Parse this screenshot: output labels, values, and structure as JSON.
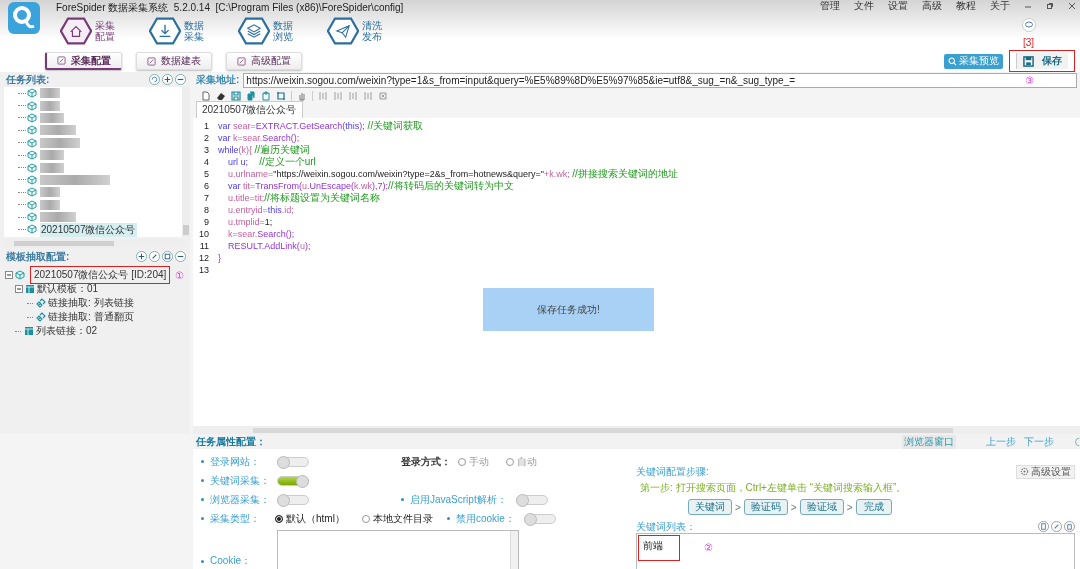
{
  "app": {
    "title": "ForeSpider 数据采集系统  5.2.0.14  [C:\\Program Files (x86)\\ForeSpider\\config]"
  },
  "menu": [
    "管理",
    "文件",
    "设置",
    "高级",
    "教程",
    "关于"
  ],
  "nav": [
    {
      "label": "采集配置",
      "selected": true
    },
    {
      "label": "数据采集",
      "selected": false
    },
    {
      "label": "数据浏览",
      "selected": false
    },
    {
      "label": "清洗发布",
      "selected": false
    }
  ],
  "subtabs": [
    {
      "label": "采集配置",
      "selected": true
    },
    {
      "label": "数据建表",
      "selected": false
    },
    {
      "label": "高级配置",
      "selected": false
    }
  ],
  "actions": {
    "preview": "采集预览",
    "save": {
      "label": "保存",
      "highlighted": true,
      "annotation": "[3]"
    }
  },
  "task_list": {
    "title": "任务列表:",
    "items": [
      {
        "kind": "blurred",
        "selected": false
      },
      {
        "kind": "blurred",
        "selected": false
      },
      {
        "kind": "blurred",
        "selected": false
      },
      {
        "kind": "blurred",
        "selected": false
      },
      {
        "kind": "blurred",
        "selected": false
      },
      {
        "kind": "blurred",
        "selected": false
      },
      {
        "kind": "blurred",
        "selected": false
      },
      {
        "kind": "blurred",
        "selected": false
      },
      {
        "kind": "blurred",
        "selected": false
      },
      {
        "kind": "blurred",
        "selected": false
      },
      {
        "kind": "blurred",
        "selected": false
      },
      {
        "kind": "text",
        "label": "20210507微信公众号",
        "selected": true
      }
    ]
  },
  "template_tree": {
    "title": "模板抽取配置:",
    "root": {
      "label": "20210507微信公众号 [ID:204]",
      "highlighted": true,
      "annotation": "①",
      "expanded": true,
      "children": [
        {
          "kind": "template",
          "label": "默认模板：01",
          "expanded": true,
          "children": [
            {
              "kind": "link",
              "label": "链接抽取: 列表链接"
            },
            {
              "kind": "link",
              "label": "链接抽取: 普通翻页"
            }
          ]
        },
        {
          "kind": "template",
          "label": "列表链接：02"
        }
      ]
    }
  },
  "url": {
    "label": "采集地址:",
    "value": "https://weixin.sogou.com/weixin?type=1&s_from=input&query=%E5%89%8D%E5%97%85&ie=utf8&_sug_=n&_sug_type_=",
    "annotation": "③"
  },
  "editor": {
    "tab": "20210507微信公众号",
    "lines": [
      {
        "number": "1",
        "tokens": [
          {
            "kind": "kw",
            "text": "var "
          },
          {
            "kind": "vr",
            "text": "sear="
          },
          {
            "kind": "fn",
            "text": "EXTRACT.GetSearch("
          },
          {
            "kind": "kw",
            "text": "this"
          },
          {
            "kind": "fn",
            "text": ");"
          },
          {
            "kind": "cm",
            "text": " //关键词获取"
          }
        ]
      },
      {
        "number": "2",
        "tokens": [
          {
            "kind": "kw",
            "text": "var "
          },
          {
            "kind": "vr",
            "text": "k=sear."
          },
          {
            "kind": "fn",
            "text": "Search();"
          }
        ]
      },
      {
        "number": "3",
        "tokens": [
          {
            "kind": "kw",
            "text": "while"
          },
          {
            "kind": "vr",
            "text": "(k){ "
          },
          {
            "kind": "cm",
            "text": "//遍历关键词"
          }
        ]
      },
      {
        "number": "4",
        "tokens": [
          {
            "kind": "kw",
            "text": "    url u;"
          },
          {
            "kind": "cm",
            "text": "    //定义一个url"
          }
        ]
      },
      {
        "number": "5",
        "tokens": [
          {
            "kind": "vr",
            "text": "    u.urlname="
          },
          {
            "kind": "st",
            "text": "\"https://weixin.sogou.com/weixin?type=2&s_from=hotnews&query=\""
          },
          {
            "kind": "vr",
            "text": "+k.wk; "
          },
          {
            "kind": "cm",
            "text": "//拼接搜索关键词的地址"
          }
        ]
      },
      {
        "number": "6",
        "tokens": [
          {
            "kind": "kw",
            "text": "    var "
          },
          {
            "kind": "vr",
            "text": "tit="
          },
          {
            "kind": "fn",
            "text": "TransFrom("
          },
          {
            "kind": "vr",
            "text": "u."
          },
          {
            "kind": "fn",
            "text": "UnEscape("
          },
          {
            "kind": "vr",
            "text": "k.wk"
          },
          {
            "kind": "fn",
            "text": "),7);"
          },
          {
            "kind": "cm",
            "text": "//将转码后的关键词转为中文"
          }
        ]
      },
      {
        "number": "7",
        "tokens": [
          {
            "kind": "vr",
            "text": "    u.title=tit;"
          },
          {
            "kind": "cm",
            "text": "//将标题设置为关键词名称"
          }
        ]
      },
      {
        "number": "8",
        "tokens": [
          {
            "kind": "vr",
            "text": "    u.entryid="
          },
          {
            "kind": "kw",
            "text": "this"
          },
          {
            "kind": "vr",
            "text": ".id;"
          }
        ]
      },
      {
        "number": "9",
        "tokens": [
          {
            "kind": "vr",
            "text": "    u.tmplid="
          },
          {
            "kind": "st",
            "text": "1;"
          }
        ]
      },
      {
        "number": "10",
        "tokens": [
          {
            "kind": "vr",
            "text": "    k=sear."
          },
          {
            "kind": "fn",
            "text": "Search();"
          }
        ]
      },
      {
        "number": "11",
        "tokens": [
          {
            "kind": "fn",
            "text": "    RESULT.AddLink("
          },
          {
            "kind": "vr",
            "text": "u"
          },
          {
            "kind": "fn",
            "text": ");"
          }
        ]
      },
      {
        "number": "12",
        "tokens": [
          {
            "kind": "fn",
            "text": "}"
          }
        ]
      },
      {
        "number": "13"
      }
    ]
  },
  "toast": "保存任务成功!",
  "props": {
    "title": "任务属性配置：",
    "browser_window": "浏览器窗口",
    "prev": "上一步",
    "next": "下一步",
    "rows": [
      [
        {
          "kind": "toggle",
          "label": "登录网站：",
          "bullet": true,
          "on": false
        },
        {
          "kind": "radio",
          "label": "登录方式：",
          "bullet": false,
          "options": [
            {
              "label": "手动",
              "selected": false,
              "disabled": true
            },
            {
              "label": "自动",
              "selected": false,
              "disabled": true
            }
          ]
        }
      ],
      [
        {
          "kind": "toggle",
          "label": "关键词采集：",
          "bullet": true,
          "on": true
        }
      ],
      [
        {
          "kind": "toggle",
          "label": "浏览器采集：",
          "bullet": true,
          "on": false
        },
        {
          "kind": "toggle",
          "label": "启用JavaScript解析：",
          "bullet": true,
          "on": false
        }
      ],
      [
        {
          "kind": "radio",
          "label": "采集类型：",
          "bullet": true,
          "options": [
            {
              "label": "默认（html）",
              "selected": true,
              "disabled": false
            },
            {
              "label": "本地文件目录",
              "selected": false,
              "disabled": false
            }
          ]
        },
        {
          "kind": "toggle",
          "label": "禁用cookie：",
          "bullet": true,
          "on": false
        }
      ],
      [
        {
          "kind": "textarea",
          "label": "Cookie：",
          "bullet": true
        }
      ]
    ]
  },
  "keyword": {
    "steps_title": "关键词配置步骤:",
    "advanced": "高级设置",
    "hint": "第一步: 打开搜索页面，Ctrl+左键单击 “关键词搜索输入框”。",
    "steps": [
      "关键词",
      "验证码",
      "验证域",
      "完成"
    ],
    "separators": [
      ">",
      ">",
      ">"
    ],
    "list_title": "关键词列表：",
    "list_value": "前端",
    "highlighted": true,
    "annotation": "②"
  }
}
